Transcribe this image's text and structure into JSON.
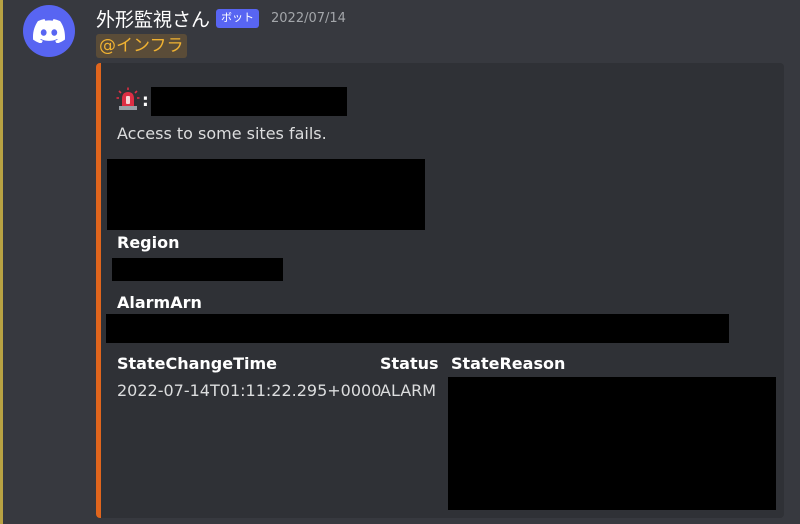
{
  "message": {
    "username": "外形監視さん",
    "bot_tag": "ボット",
    "timestamp": "2022/07/14",
    "mention": "@インフラ",
    "avatar_icon": "discord-logo-icon",
    "accent_colors": {
      "avatar_bg": "#5865f2",
      "embed_border": "#e0651d",
      "mention_text": "#f0b232"
    }
  },
  "embed": {
    "title_icon": "siren-icon",
    "title_suffix": ":",
    "description": "Access to some sites fails.",
    "fields": {
      "region_name": "Region",
      "alarm_arn_name": "AlarmArn",
      "state_change_time_name": "StateChangeTime",
      "state_change_time_value": "2022-07-14T01:11:22.295+0000",
      "status_name": "Status",
      "status_value": "ALARM",
      "state_reason_name": "StateReason"
    }
  }
}
